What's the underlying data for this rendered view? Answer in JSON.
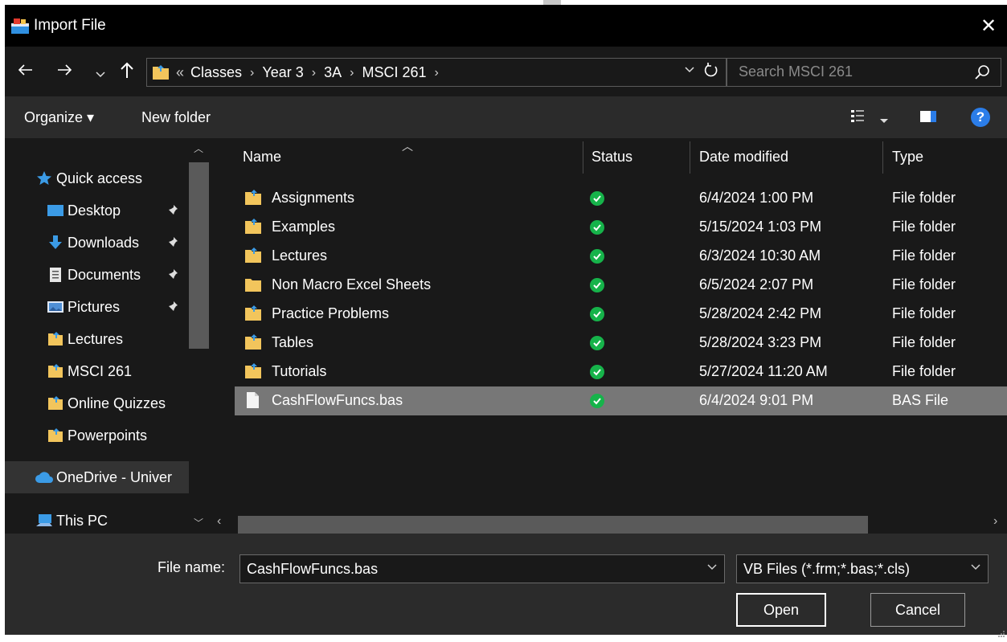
{
  "window": {
    "title": "Import File",
    "close_glyph": "✕"
  },
  "address": {
    "overflow": "«",
    "crumbs": [
      "Classes",
      "Year 3",
      "3A",
      "MSCI 261"
    ],
    "search_placeholder": "Search MSCI 261"
  },
  "toolbar": {
    "organize_label": "Organize ▾",
    "new_folder_label": "New folder",
    "help_label": "?"
  },
  "nav": {
    "quick_access": "Quick access",
    "items": [
      {
        "label": "Desktop",
        "icon": "desktop-icon",
        "pinned": true
      },
      {
        "label": "Downloads",
        "icon": "download-icon",
        "pinned": true
      },
      {
        "label": "Documents",
        "icon": "document-icon",
        "pinned": true
      },
      {
        "label": "Pictures",
        "icon": "pictures-icon",
        "pinned": true
      },
      {
        "label": "Lectures",
        "icon": "folder-icon",
        "pinned": false
      },
      {
        "label": "MSCI 261",
        "icon": "folder-icon",
        "pinned": false
      },
      {
        "label": "Online Quizzes",
        "icon": "folder-icon",
        "pinned": false
      },
      {
        "label": "Powerpoints",
        "icon": "folder-icon",
        "pinned": false
      }
    ],
    "onedrive": "OneDrive - Univer",
    "thispc": "This PC"
  },
  "columns": {
    "name": "Name",
    "status": "Status",
    "date": "Date modified",
    "type": "Type"
  },
  "files": [
    {
      "name": "Assignments",
      "date": "6/4/2024 1:00 PM",
      "type": "File folder",
      "kind": "folder"
    },
    {
      "name": "Examples",
      "date": "5/15/2024 1:03 PM",
      "type": "File folder",
      "kind": "folder"
    },
    {
      "name": "Lectures",
      "date": "6/3/2024 10:30 AM",
      "type": "File folder",
      "kind": "folder"
    },
    {
      "name": "Non Macro Excel Sheets",
      "date": "6/5/2024 2:07 PM",
      "type": "File folder",
      "kind": "folder"
    },
    {
      "name": "Practice Problems",
      "date": "5/28/2024 2:42 PM",
      "type": "File folder",
      "kind": "folder"
    },
    {
      "name": "Tables",
      "date": "5/28/2024 3:23 PM",
      "type": "File folder",
      "kind": "folder"
    },
    {
      "name": "Tutorials",
      "date": "5/27/2024 11:20 AM",
      "type": "File folder",
      "kind": "folder"
    },
    {
      "name": "CashFlowFuncs.bas",
      "date": "6/4/2024 9:01 PM",
      "type": "BAS File",
      "kind": "file",
      "selected": true
    }
  ],
  "bottom": {
    "file_name_label": "File name:",
    "file_name_value": "CashFlowFuncs.bas",
    "filter_value": "VB Files (*.frm;*.bas;*.cls)",
    "open_label": "Open",
    "cancel_label": "Cancel"
  },
  "colors": {
    "background": "#191919",
    "toolbar": "#2b2b2b",
    "selection": "#777777",
    "status_ok": "#16b34a",
    "folder": "#f2c55c",
    "accent": "#2b7de9"
  }
}
